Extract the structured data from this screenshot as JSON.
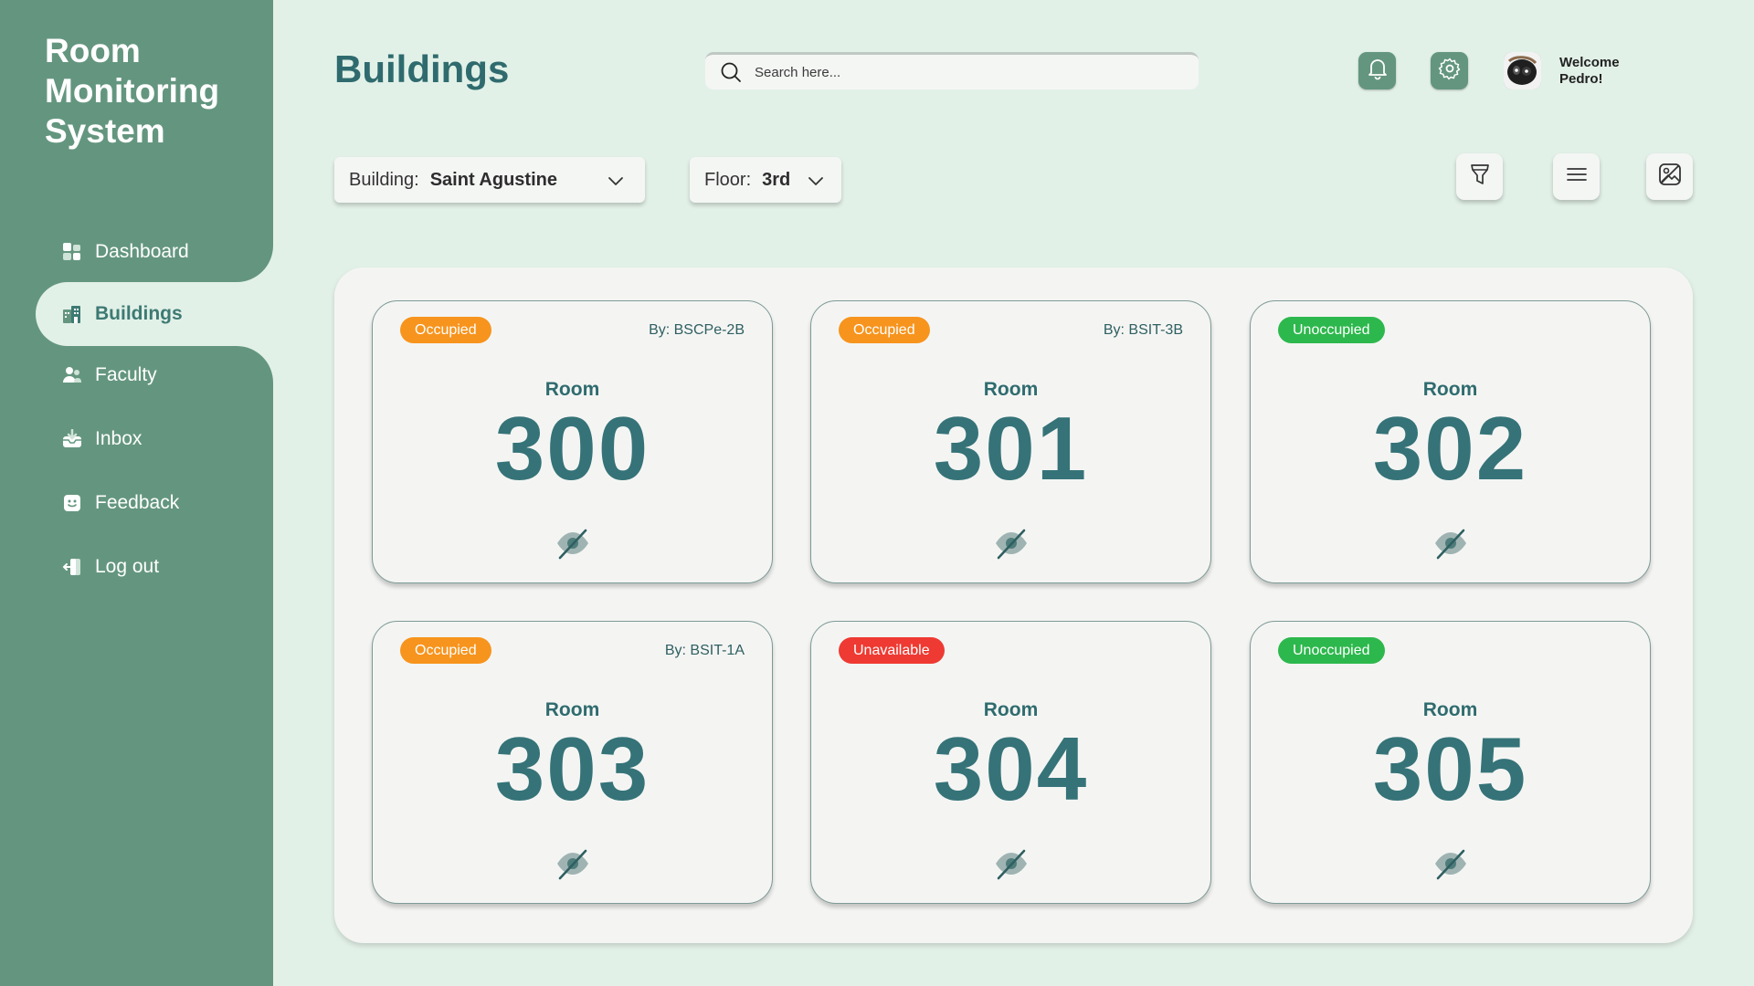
{
  "app": {
    "title": "Room Monitoring System"
  },
  "sidebar": {
    "items": [
      {
        "label": "Dashboard",
        "icon": "dashboard-icon"
      },
      {
        "label": "Buildings",
        "icon": "building-icon",
        "active": true
      },
      {
        "label": "Faculty",
        "icon": "users-icon"
      },
      {
        "label": "Inbox",
        "icon": "inbox-icon"
      },
      {
        "label": "Feedback",
        "icon": "feedback-icon"
      },
      {
        "label": "Log out",
        "icon": "logout-icon"
      }
    ]
  },
  "header": {
    "title": "Buildings",
    "search_placeholder": "Search here...",
    "welcome_line1": "Welcome",
    "welcome_line2": "Pedro!"
  },
  "filters": {
    "building_label": "Building:",
    "building_value": "Saint Agustine",
    "floor_label": "Floor:",
    "floor_value": "3rd"
  },
  "room_label": "Room",
  "rooms": [
    {
      "number": "300",
      "status": "Occupied",
      "by": "By: BSCPe-2B"
    },
    {
      "number": "301",
      "status": "Occupied",
      "by": "By: BSIT-3B"
    },
    {
      "number": "302",
      "status": "Unoccupied",
      "by": ""
    },
    {
      "number": "303",
      "status": "Occupied",
      "by": "By: BSIT-1A"
    },
    {
      "number": "304",
      "status": "Unavailable",
      "by": ""
    },
    {
      "number": "305",
      "status": "Unoccupied",
      "by": ""
    }
  ],
  "colors": {
    "sidebar": "#64967f",
    "background": "#e2f1e8",
    "occupied": "#f7941d",
    "unoccupied": "#2db84d",
    "unavailable": "#ee3a32",
    "accent_text": "#357378"
  }
}
